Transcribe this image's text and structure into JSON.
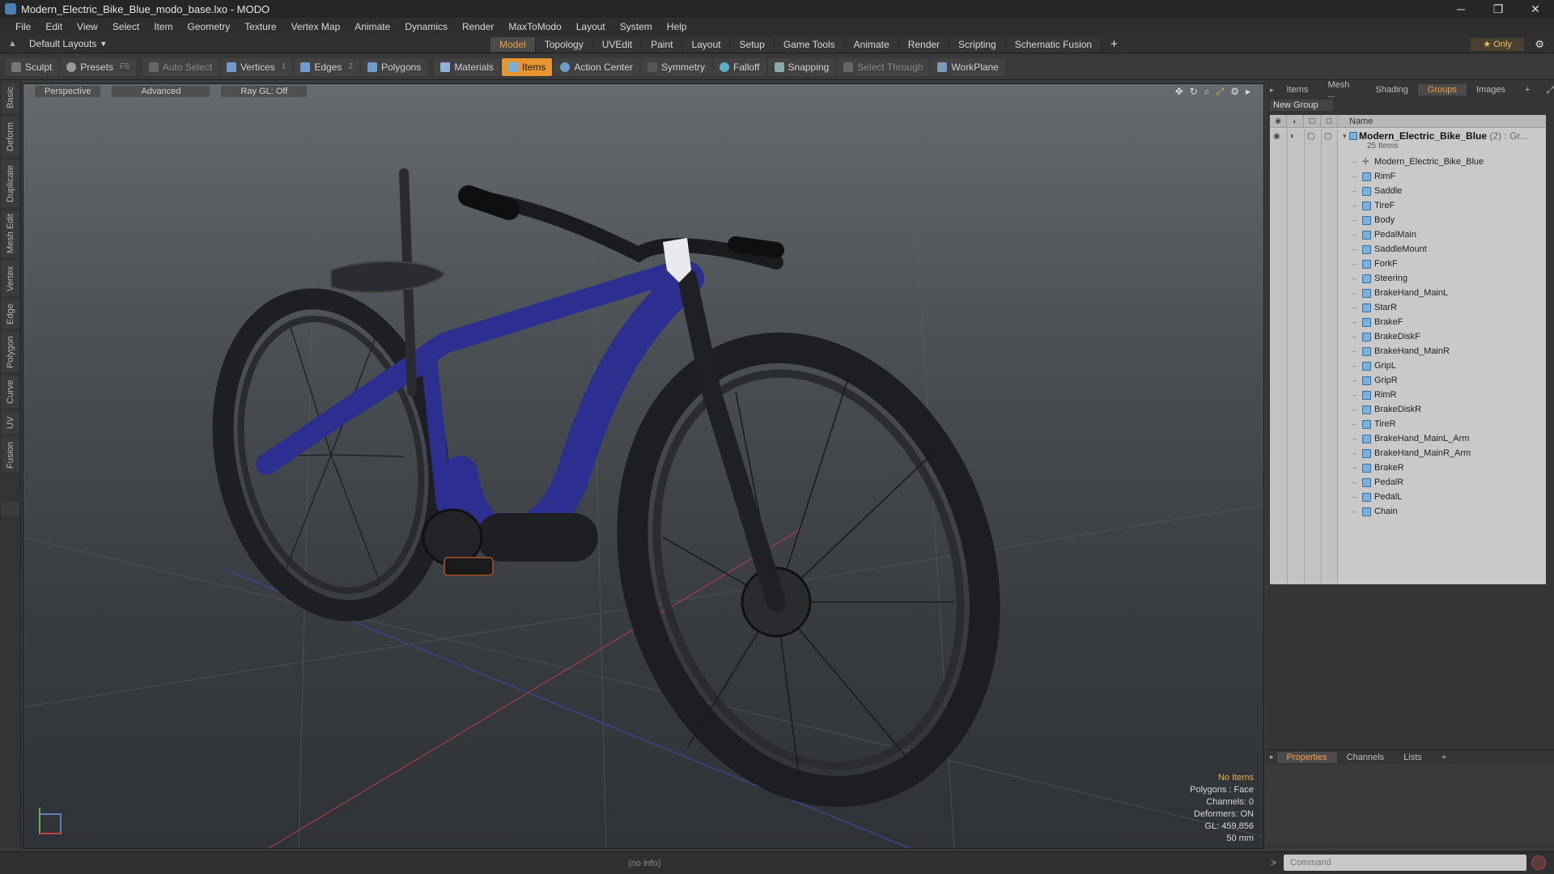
{
  "window": {
    "title": "Modern_Electric_Bike_Blue_modo_base.lxo - MODO",
    "controls": [
      "─",
      "❐",
      "✕"
    ]
  },
  "menu": [
    "File",
    "Edit",
    "View",
    "Select",
    "Item",
    "Geometry",
    "Texture",
    "Vertex Map",
    "Animate",
    "Dynamics",
    "Render",
    "MaxToModo",
    "Layout",
    "System",
    "Help"
  ],
  "layout_bar": {
    "layout_dropdown": "Default Layouts",
    "tabs": [
      {
        "label": "Model",
        "active": true
      },
      {
        "label": "Topology",
        "active": false
      },
      {
        "label": "UVEdit",
        "active": false
      },
      {
        "label": "Paint",
        "active": false
      },
      {
        "label": "Layout",
        "active": false
      },
      {
        "label": "Setup",
        "active": false
      },
      {
        "label": "Game Tools",
        "active": false
      },
      {
        "label": "Animate",
        "active": false
      },
      {
        "label": "Render",
        "active": false
      },
      {
        "label": "Scripting",
        "active": false
      },
      {
        "label": "Schematic Fusion",
        "active": false
      }
    ],
    "add_tab": "+",
    "only_label": "Only"
  },
  "toolbar": {
    "sculpt": "Sculpt",
    "presets": "Presets",
    "presets_key": "F6",
    "auto_select": "Auto Select",
    "vertices": "Vertices",
    "vertices_key": "1",
    "edges": "Edges",
    "edges_key": "2",
    "polygons": "Polygons",
    "materials": "Materials",
    "items": "Items",
    "action_center": "Action Center",
    "symmetry": "Symmetry",
    "falloff": "Falloff",
    "snapping": "Snapping",
    "select_through": "Select Through",
    "workplane": "WorkPlane"
  },
  "left_tabs": [
    "Basic",
    "Deform",
    "Duplicate",
    "Mesh Edit",
    "Vertex",
    "Edge",
    "Polygon",
    "Curve",
    "UV",
    "Fusion"
  ],
  "viewport": {
    "view_mode": "Perspective",
    "shading": "Advanced",
    "raygl": "Ray GL: Off",
    "info": {
      "selection": "No Items",
      "polygons": "Polygons : Face",
      "channels": "Channels: 0",
      "deformers": "Deformers: ON",
      "gl": "GL: 459,856",
      "lens": "50 mm"
    }
  },
  "right_panel": {
    "tabs": [
      {
        "label": "Items",
        "active": false
      },
      {
        "label": "Mesh ...",
        "active": false
      },
      {
        "label": "Shading",
        "active": false
      },
      {
        "label": "Groups",
        "active": true
      },
      {
        "label": "Images",
        "active": false
      },
      {
        "label": "+",
        "active": false
      }
    ],
    "new_group": "New Group",
    "column_name": "Name",
    "group": {
      "name": "Modern_Electric_Bike_Blue",
      "count": "(2)",
      "type": ": Gr...",
      "sub": "25 Items"
    },
    "items": [
      {
        "label": "Modern_Electric_Bike_Blue",
        "kind": "locator"
      },
      {
        "label": "RimF",
        "kind": "mesh"
      },
      {
        "label": "Saddle",
        "kind": "mesh"
      },
      {
        "label": "TireF",
        "kind": "mesh"
      },
      {
        "label": "Body",
        "kind": "mesh"
      },
      {
        "label": "PedalMain",
        "kind": "mesh"
      },
      {
        "label": "SaddleMount",
        "kind": "mesh"
      },
      {
        "label": "ForkF",
        "kind": "mesh"
      },
      {
        "label": "Steering",
        "kind": "mesh"
      },
      {
        "label": "BrakeHand_MainL",
        "kind": "mesh"
      },
      {
        "label": "StarR",
        "kind": "mesh"
      },
      {
        "label": "BrakeF",
        "kind": "mesh"
      },
      {
        "label": "BrakeDiskF",
        "kind": "mesh"
      },
      {
        "label": "BrakeHand_MainR",
        "kind": "mesh"
      },
      {
        "label": "GripL",
        "kind": "mesh"
      },
      {
        "label": "GripR",
        "kind": "mesh"
      },
      {
        "label": "RimR",
        "kind": "mesh"
      },
      {
        "label": "BrakeDiskR",
        "kind": "mesh"
      },
      {
        "label": "TireR",
        "kind": "mesh"
      },
      {
        "label": "BrakeHand_MainL_Arm",
        "kind": "mesh"
      },
      {
        "label": "BrakeHand_MainR_Arm",
        "kind": "mesh"
      },
      {
        "label": "BrakeR",
        "kind": "mesh"
      },
      {
        "label": "PedalR",
        "kind": "mesh"
      },
      {
        "label": "PedalL",
        "kind": "mesh"
      },
      {
        "label": "Chain",
        "kind": "mesh"
      }
    ],
    "props_tabs": [
      {
        "label": "Properties",
        "active": true
      },
      {
        "label": "Channels",
        "active": false
      },
      {
        "label": "Lists",
        "active": false
      },
      {
        "label": "+",
        "active": false
      }
    ]
  },
  "statusbar": {
    "info": "(no info)",
    "command_placeholder": "Command"
  },
  "colors": {
    "accent": "#e6962f",
    "bike_frame": "#2c2f8f"
  }
}
